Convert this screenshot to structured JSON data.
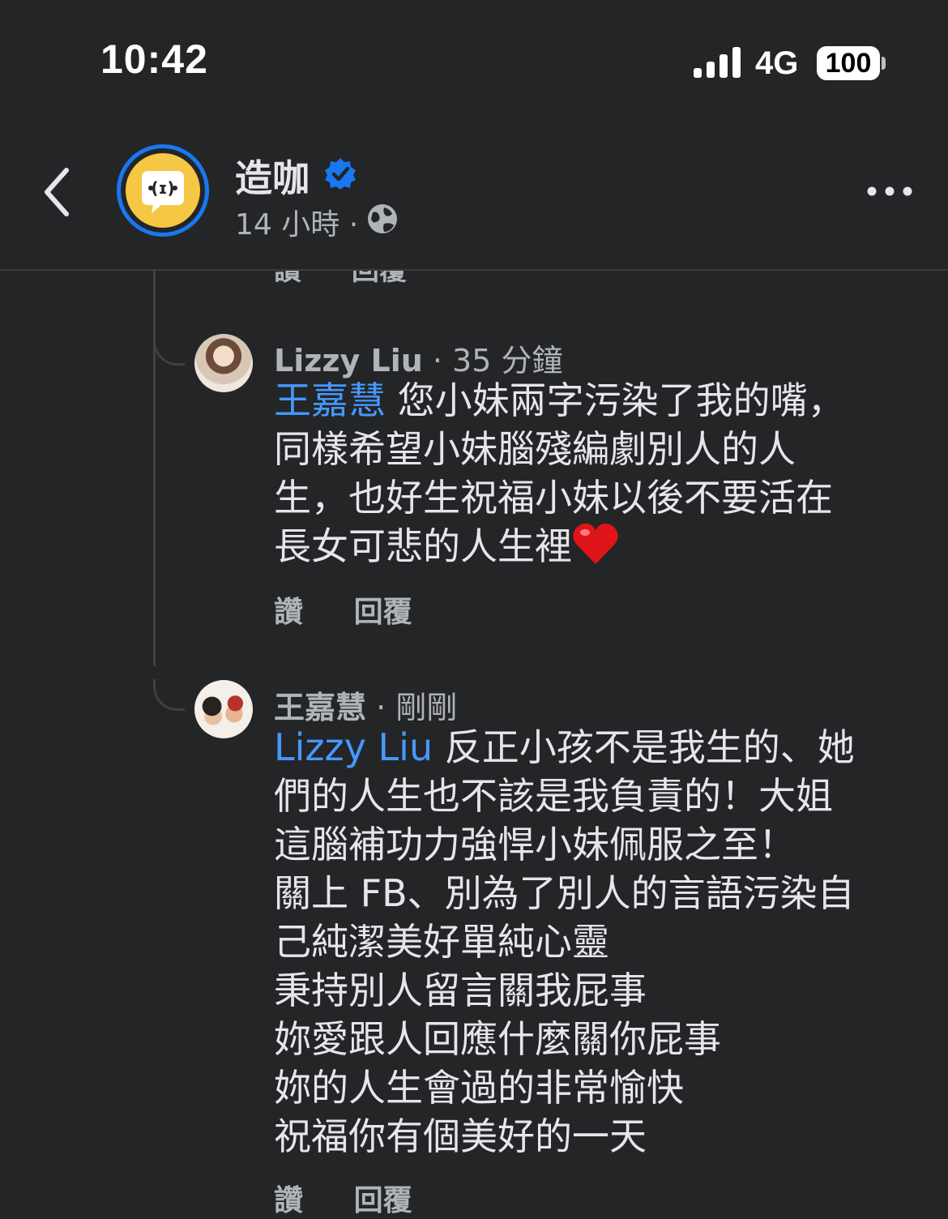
{
  "status_bar": {
    "time": "10:42",
    "network": "4G",
    "battery": "100"
  },
  "header": {
    "page_name": "造咖",
    "time_ago": "14 小時",
    "separator": "·",
    "icons": {
      "back": "chevron-left-icon",
      "verified": "verified-badge-icon",
      "audience": "globe-icon",
      "more": "more-dots-icon"
    },
    "colors": {
      "verified": "#1877f2",
      "avatar_ring": "#1877f2",
      "avatar_fill": "#f6c744"
    }
  },
  "previous_actions": {
    "like": "讚",
    "reply": "回覆"
  },
  "comments": [
    {
      "author": "Lizzy Liu",
      "time": "35 分鐘",
      "mention": "王嘉慧",
      "lines": [
        "您小妹兩字污染了我的嘴，",
        "同樣希望小妹腦殘編劇別人的人",
        "生，也好生祝福小妹以後不要活在",
        "長女可悲的人生裡"
      ],
      "emoji": "heart-icon",
      "like": "讚",
      "reply": "回覆"
    },
    {
      "author": "王嘉慧",
      "time": "剛剛",
      "mention": "Lizzy Liu",
      "lines": [
        "反正小孩不是我生的、她",
        "們的人生也不該是我負責的！大姐",
        "這腦補功力強悍小妹佩服之至！",
        "關上 FB、別為了別人的言語污染自",
        "己純潔美好單純心靈",
        "秉持別人留言關我屁事",
        "妳愛跟人回應什麼關你屁事",
        "妳的人生會過的非常愉快",
        "祝福你有個美好的一天"
      ],
      "like": "讚",
      "reply": "回覆"
    }
  ],
  "colors": {
    "background": "#242526",
    "text": "#e4e6eb",
    "secondary_text": "#b0b3b8",
    "mention": "#4599ff"
  }
}
